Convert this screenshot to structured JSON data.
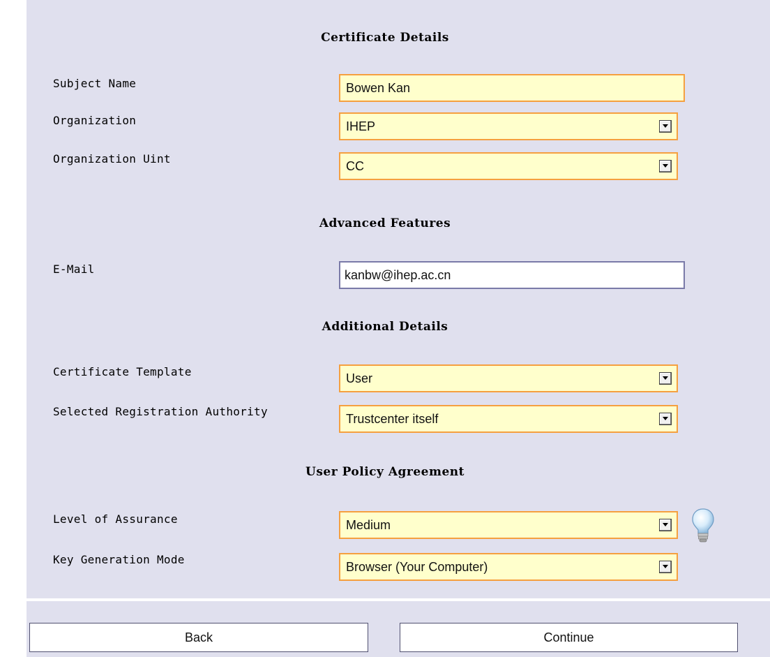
{
  "sections": {
    "certificate_details": "Certificate Details",
    "advanced_features": "Advanced Features",
    "additional_details": "Additional Details",
    "user_policy_agreement": "User Policy Agreement"
  },
  "fields": {
    "subject_name": {
      "label": "Subject Name",
      "value": "Bowen Kan"
    },
    "organization": {
      "label": "Organization",
      "value": "IHEP"
    },
    "organization_unit": {
      "label": "Organization Uint",
      "value": "CC"
    },
    "email": {
      "label": "E-Mail",
      "value": "kanbw@ihep.ac.cn"
    },
    "certificate_template": {
      "label": "Certificate Template",
      "value": "User"
    },
    "registration_authority": {
      "label": "Selected Registration Authority",
      "value": "Trustcenter itself"
    },
    "level_of_assurance": {
      "label": "Level of Assurance",
      "value": "Medium"
    },
    "key_generation_mode": {
      "label": "Key Generation Mode",
      "value": "Browser (Your Computer)"
    }
  },
  "buttons": {
    "back": "Back",
    "continue": "Continue"
  },
  "icons": {
    "dropdown": "chevron-down-icon",
    "hint": "lightbulb-icon"
  },
  "colors": {
    "panel_bg": "#e0e0ee",
    "field_bg": "#ffffcc",
    "field_border": "#f5a040",
    "plain_field_border": "#7a7aa8"
  }
}
